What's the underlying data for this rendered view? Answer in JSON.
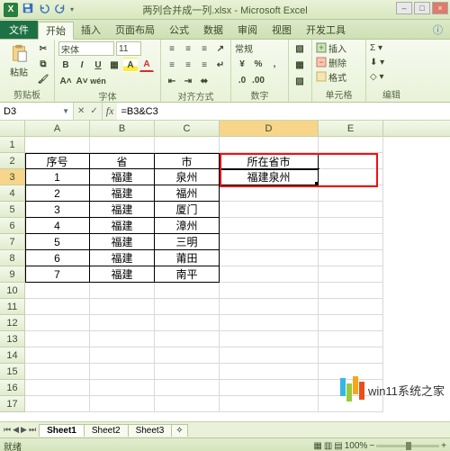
{
  "title": {
    "doc": "两列合并成一列.xlsx - Microsoft Excel"
  },
  "qat": {
    "save": "save-icon",
    "undo": "undo-icon",
    "redo": "redo-icon"
  },
  "win": {
    "min": "–",
    "max": "□",
    "close": "×",
    "help": "?"
  },
  "tabs": {
    "file": "文件",
    "items": [
      "开始",
      "插入",
      "页面布局",
      "公式",
      "数据",
      "审阅",
      "视图",
      "开发工具"
    ],
    "active": 0
  },
  "ribbon": {
    "clipboard": {
      "paste": "粘贴",
      "label": "剪贴板"
    },
    "font": {
      "name": "宋体",
      "size": "11",
      "label": "字体",
      "bold": "B",
      "italic": "I",
      "under": "U"
    },
    "align": {
      "label": "对齐方式"
    },
    "number": {
      "fmt": "常规",
      "label": "数字",
      "pct": "%",
      "comma": ",",
      "dec_inc": ".0",
      "dec_dec": ".00"
    },
    "cells": {
      "insert": "插入",
      "delete": "删除",
      "format": "格式",
      "label": "单元格"
    },
    "edit": {
      "label": "编辑"
    }
  },
  "namebox": "D3",
  "formula": "=B3&C3",
  "cols": [
    "A",
    "B",
    "C",
    "D",
    "E"
  ],
  "row_count": 17,
  "selected_col": "D",
  "selected_row": 3,
  "table": {
    "header": {
      "A": "序号",
      "B": "省",
      "C": "市",
      "D": "所在省市"
    },
    "rows": [
      {
        "A": "1",
        "B": "福建",
        "C": "泉州",
        "D": "福建泉州"
      },
      {
        "A": "2",
        "B": "福建",
        "C": "福州",
        "D": ""
      },
      {
        "A": "3",
        "B": "福建",
        "C": "厦门",
        "D": ""
      },
      {
        "A": "4",
        "B": "福建",
        "C": "漳州",
        "D": ""
      },
      {
        "A": "5",
        "B": "福建",
        "C": "三明",
        "D": ""
      },
      {
        "A": "6",
        "B": "福建",
        "C": "莆田",
        "D": ""
      },
      {
        "A": "7",
        "B": "福建",
        "C": "南平",
        "D": ""
      }
    ]
  },
  "sheets": {
    "items": [
      "Sheet1",
      "Sheet2",
      "Sheet3"
    ],
    "active": 0
  },
  "status": {
    "mode": "就绪",
    "zoom": "100%"
  },
  "watermark": "win11系统之家"
}
